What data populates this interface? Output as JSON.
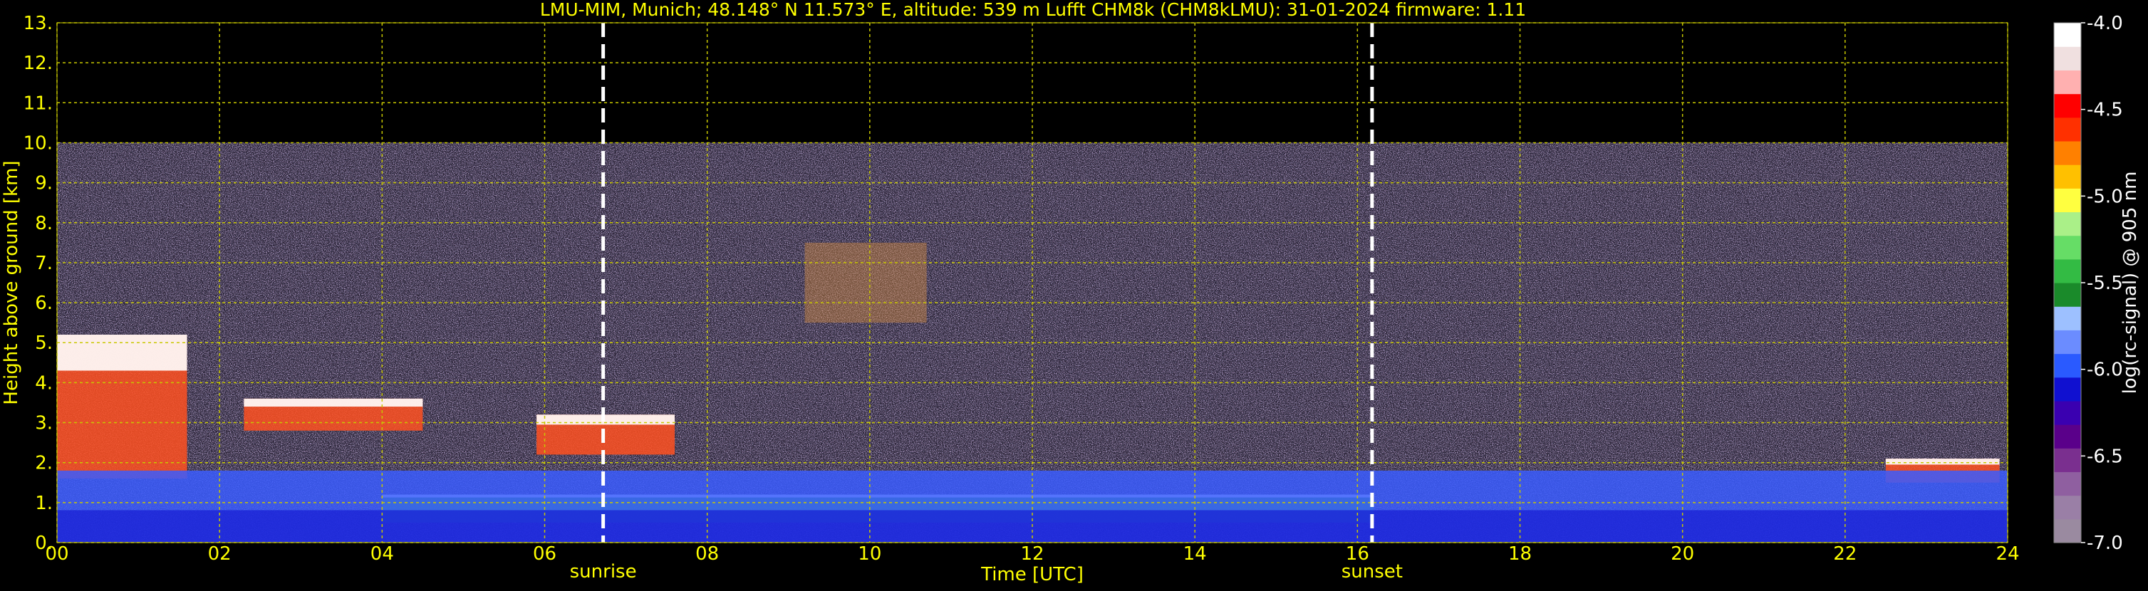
{
  "chart_data": {
    "type": "heatmap",
    "title": "LMU-MIM, Munich; 48.148° N 11.573° E, altitude: 539 m    Lufft CHM8k (CHM8kLMU): 31-01-2024    firmware: 1.11",
    "xlabel": "Time [UTC]",
    "ylabel": "Height above ground [km]",
    "xlim": [
      0,
      24
    ],
    "ylim": [
      0,
      13
    ],
    "measurement_top_km": 10,
    "grid": true,
    "x_ticks": [
      "00",
      "02",
      "04",
      "06",
      "08",
      "10",
      "12",
      "14",
      "16",
      "18",
      "20",
      "22",
      "24"
    ],
    "y_ticks": [
      "0.",
      "1.",
      "2.",
      "3.",
      "4.",
      "5.",
      "6.",
      "7.",
      "8.",
      "9.",
      "10.",
      "11.",
      "12.",
      "13."
    ],
    "markers": [
      {
        "name": "sunrise",
        "x": 6.72
      },
      {
        "name": "sunset",
        "x": 16.18
      }
    ],
    "colorbar": {
      "label": "log(rc-signal) @ 905 nm",
      "range": [
        -7.0,
        -4.0
      ],
      "ticks": [
        "-4.0",
        "-4.5",
        "-5.0",
        "-5.5",
        "-6.0",
        "-6.5",
        "-7.0"
      ]
    },
    "features": [
      {
        "kind": "cloud",
        "t": [
          0.0,
          1.6
        ],
        "h": [
          1.6,
          5.2
        ]
      },
      {
        "kind": "cloud",
        "t": [
          2.3,
          4.5
        ],
        "h": [
          2.8,
          3.6
        ]
      },
      {
        "kind": "cloud",
        "t": [
          5.9,
          7.6
        ],
        "h": [
          2.2,
          3.2
        ]
      },
      {
        "kind": "cloud",
        "t": [
          22.5,
          23.9
        ],
        "h": [
          1.5,
          2.1
        ]
      },
      {
        "kind": "cloud_layer",
        "t": [
          4.0,
          16.2
        ],
        "h": [
          0.5,
          1.2
        ]
      },
      {
        "kind": "aerosol_layer",
        "t": [
          0.0,
          24.0
        ],
        "h": [
          0.0,
          1.8
        ]
      },
      {
        "kind": "faint_scatter",
        "t": [
          9.2,
          10.7
        ],
        "h": [
          5.5,
          7.5
        ]
      }
    ]
  },
  "colors": {
    "text": "#ffff00",
    "grid": "#c8c800",
    "background": "#000000",
    "colormap": [
      "#9a8aa0",
      "#9a7fa6",
      "#8f5fa0",
      "#7a2f8f",
      "#5a008a",
      "#3a00b0",
      "#1010d0",
      "#2a5aff",
      "#6b8cff",
      "#9dc0ff",
      "#1a8a2a",
      "#33bb44",
      "#66dd66",
      "#aaf088",
      "#ffff40",
      "#ffc000",
      "#ff8000",
      "#ff3000",
      "#ff0000",
      "#ffb0b0",
      "#f0e0e0",
      "#ffffff"
    ]
  }
}
